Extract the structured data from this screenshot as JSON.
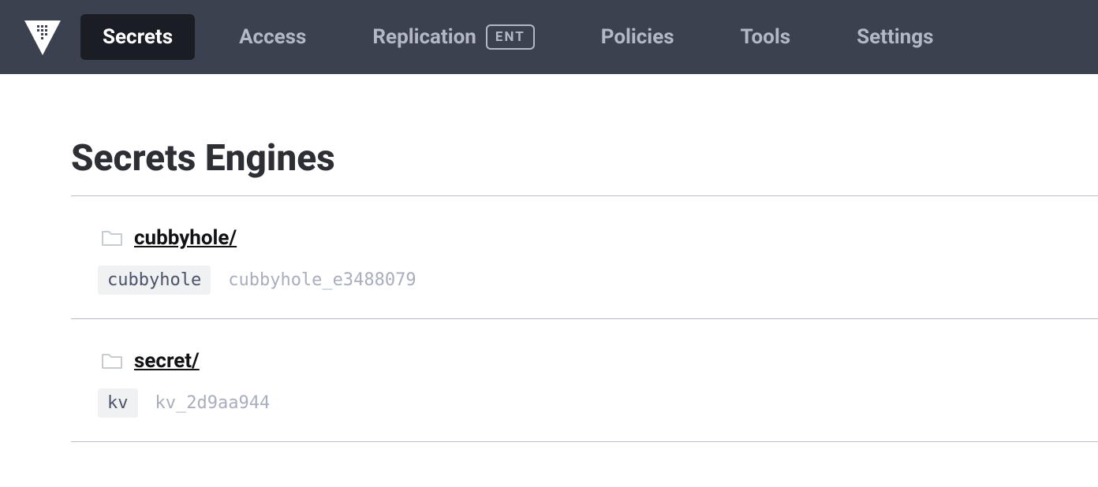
{
  "nav": {
    "items": [
      {
        "label": "Secrets",
        "active": true
      },
      {
        "label": "Access",
        "active": false
      },
      {
        "label": "Replication",
        "active": false,
        "badge": "ENT"
      },
      {
        "label": "Policies",
        "active": false
      },
      {
        "label": "Tools",
        "active": false
      },
      {
        "label": "Settings",
        "active": false
      }
    ]
  },
  "page": {
    "title": "Secrets Engines"
  },
  "engines": [
    {
      "name": "cubbyhole/",
      "type": "cubbyhole",
      "accessor": "cubbyhole_e3488079"
    },
    {
      "name": "secret/",
      "type": "kv",
      "accessor": "kv_2d9aa944"
    }
  ]
}
